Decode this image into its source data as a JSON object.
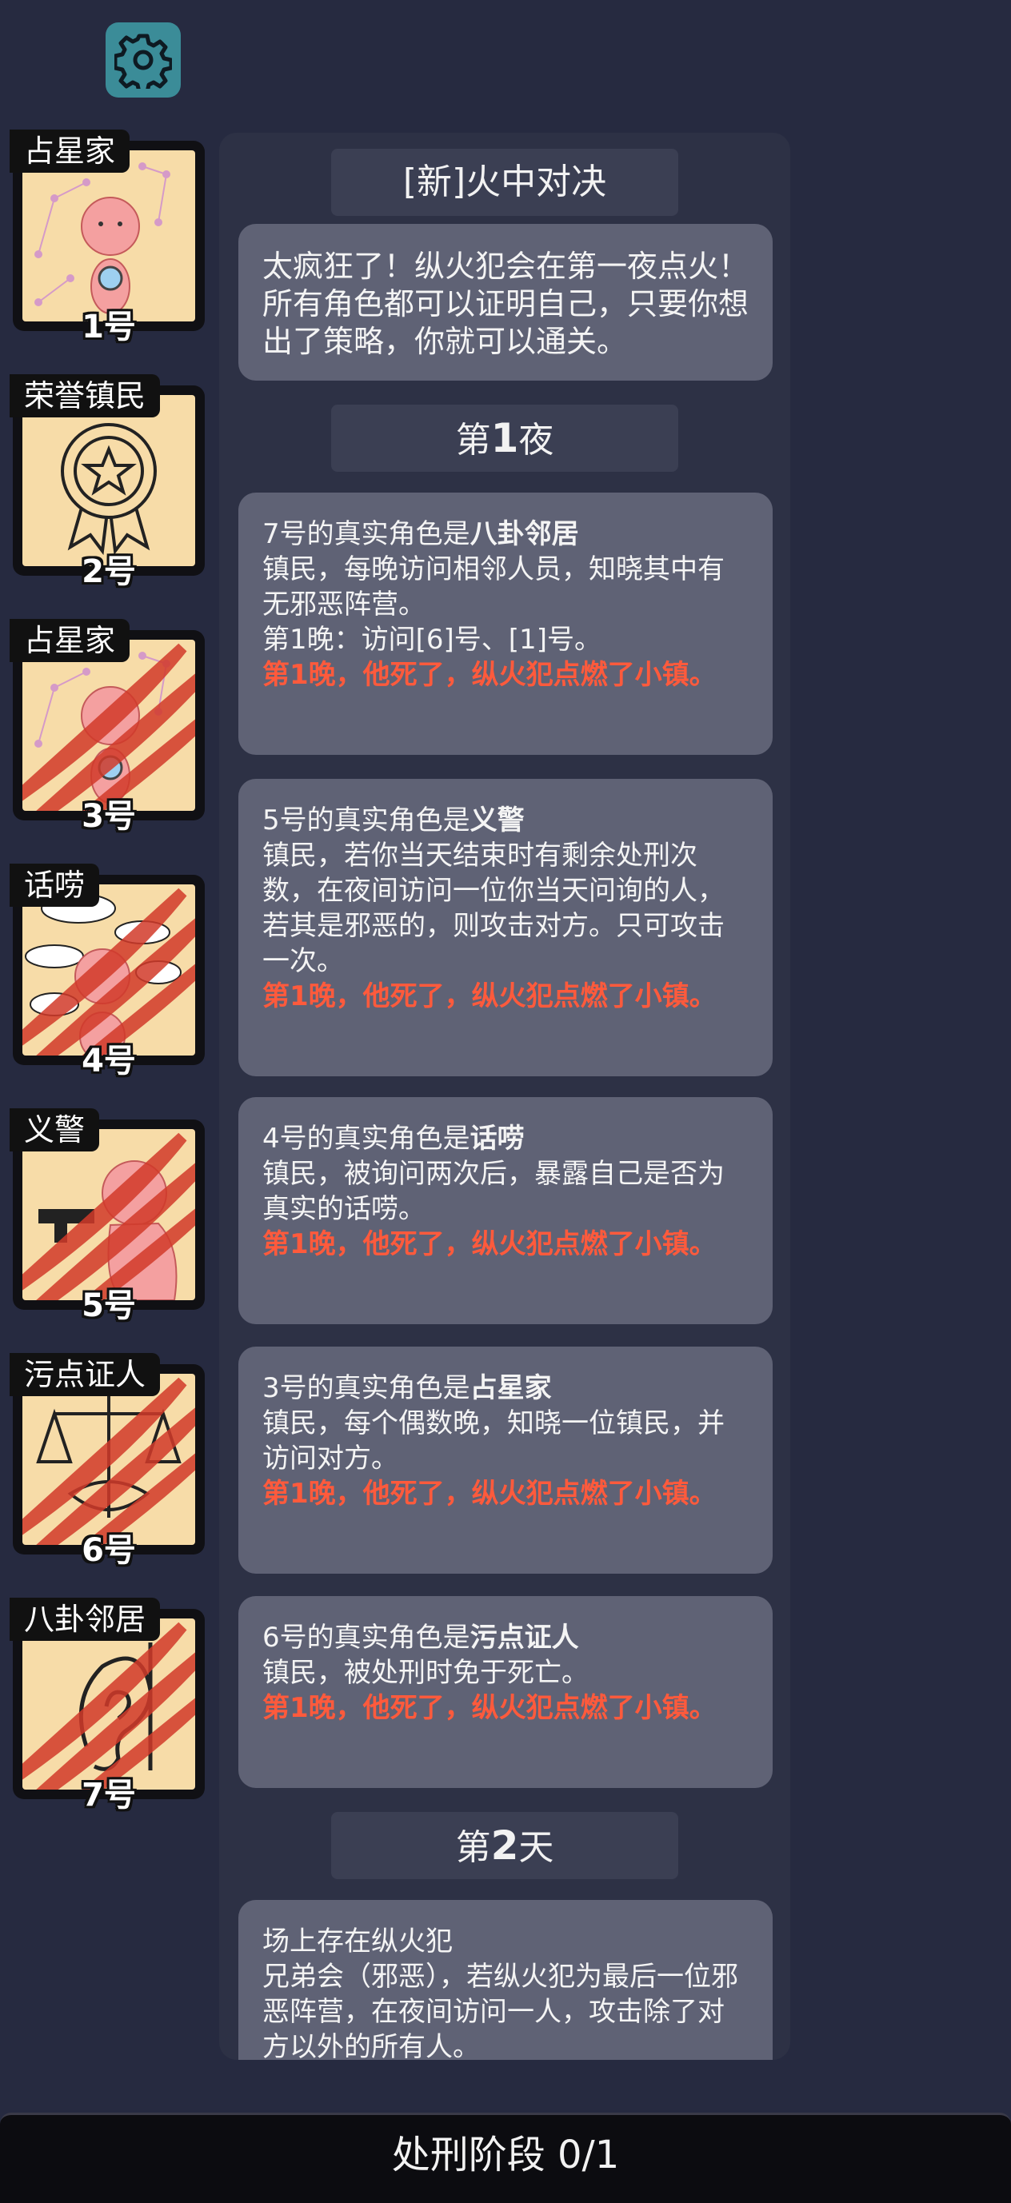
{
  "settings": {
    "icon": "gear-icon"
  },
  "roles": [
    {
      "name": "占星家",
      "number": "1号",
      "dead": false,
      "art": "astrologer"
    },
    {
      "name": "荣誉镇民",
      "number": "2号",
      "dead": false,
      "art": "medal"
    },
    {
      "name": "占星家",
      "number": "3号",
      "dead": true,
      "art": "astrologer"
    },
    {
      "name": "话唠",
      "number": "4号",
      "dead": true,
      "art": "chatter"
    },
    {
      "name": "义警",
      "number": "5号",
      "dead": true,
      "art": "vigilante"
    },
    {
      "name": "污点证人",
      "number": "6号",
      "dead": true,
      "art": "witness"
    },
    {
      "name": "八卦邻居",
      "number": "7号",
      "dead": true,
      "art": "ear"
    }
  ],
  "log": {
    "title": "[新]火中对决",
    "intro": "太疯狂了！纵火犯会在第一夜点火！所有角色都可以证明自己，只要你想出了策略，你就可以通关。",
    "night1_prefix": "第",
    "night1_num": "1",
    "night1_suffix": "夜",
    "entries": [
      {
        "head": "7号的真实角色是",
        "role": "八卦邻居",
        "desc": "镇民，每晚访问相邻人员，知晓其中有无邪恶阵营。",
        "extra": "第1晚：访问[6]号、[1]号。",
        "death": "第1晚，他死了，纵火犯点燃了小镇。"
      },
      {
        "head": "5号的真实角色是",
        "role": "义警",
        "desc": "镇民，若你当天结束时有剩余处刑次数，在夜间访问一位你当天问询的人，若其是邪恶的，则攻击对方。只可攻击一次。",
        "death": "第1晚，他死了，纵火犯点燃了小镇。"
      },
      {
        "head": "4号的真实角色是",
        "role": "话唠",
        "desc": "镇民，被询问两次后，暴露自己是否为真实的话唠。",
        "death": "第1晚，他死了，纵火犯点燃了小镇。"
      },
      {
        "head": "3号的真实角色是",
        "role": "占星家",
        "desc": "镇民，每个偶数晚，知晓一位镇民，并访问对方。",
        "death": "第1晚，他死了，纵火犯点燃了小镇。"
      },
      {
        "head": "6号的真实角色是",
        "role": "污点证人",
        "desc": "镇民，被处刑时免于死亡。",
        "death": "第1晚，他死了，纵火犯点燃了小镇。"
      }
    ],
    "day2_prefix": "第",
    "day2_num": "2",
    "day2_suffix": "天",
    "day2_title": "场上存在纵火犯",
    "day2_desc": "兄弟会（邪恶），若纵火犯为最后一位邪恶阵营，在夜间访问一人，攻击除了对方以外的所有人。"
  },
  "footer": {
    "label": "处刑阶段 0/1"
  },
  "colors": {
    "background": "#262a40",
    "panel": "#2d3145",
    "bubble": "#5f6275",
    "death_text": "#ff5a3c",
    "card_art": "#f7dca8",
    "slash": "#d23a2a"
  }
}
